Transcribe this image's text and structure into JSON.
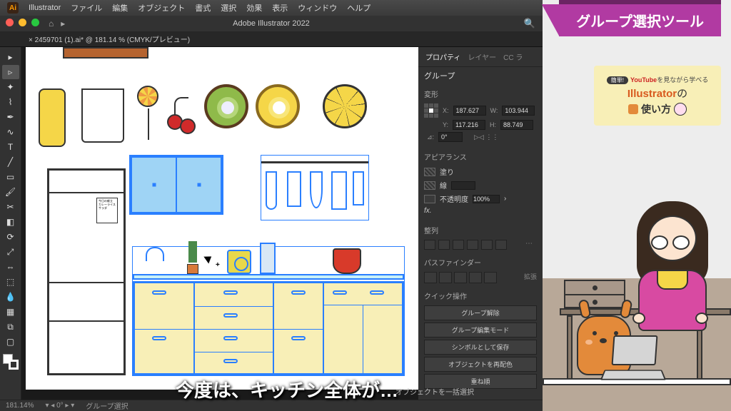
{
  "banner": {
    "title": "グループ選択ツール"
  },
  "info_card": {
    "line1_pill": "簡単!",
    "line1_bold": "YouTube",
    "line1_rest": "を見ながら学べる",
    "line2_main": "Illustrator",
    "line2_suffix": "の",
    "line3": "使い方"
  },
  "menubar": {
    "app": "Illustrator",
    "items": [
      "ファイル",
      "編集",
      "オブジェクト",
      "書式",
      "選択",
      "効果",
      "表示",
      "ウィンドウ",
      "ヘルプ"
    ]
  },
  "titlebar": {
    "title": "Adobe Illustrator 2022"
  },
  "doctab": {
    "label": "× 2459701 (1).ai* @ 181.14 % (CMYK/プレビュー)"
  },
  "panel": {
    "tabs": [
      "プロパティ",
      "レイヤー",
      "CC ラ"
    ],
    "group": "グループ",
    "sections": {
      "transform": "変形",
      "appearance": "アピアランス",
      "align": "整列",
      "pathfinder": "パスファインダー",
      "quick": "クイック操作"
    },
    "transform": {
      "x": "187.627",
      "y": "117.216",
      "w": "103.944",
      "h": "88.749",
      "rotate": "0°"
    },
    "appearance": {
      "fill": "塗り",
      "stroke": "線",
      "stroke_val": "",
      "opacity": "不透明度",
      "opacity_val": "100%"
    },
    "pathfinder_expand": "拡張",
    "quick_actions": [
      "グループ解除",
      "グループ編集モード",
      "シンボルとして保存",
      "オブジェクトを再配色",
      "重ね順"
    ],
    "batch_select": "オブジェクトを一括選択"
  },
  "statusbar": {
    "zoom": "181.14%",
    "mode": "グループ選択"
  },
  "caption": "今度は、キッチン全体が…",
  "fridge_note": "今日の献立\nカレーライス\nサラダ"
}
